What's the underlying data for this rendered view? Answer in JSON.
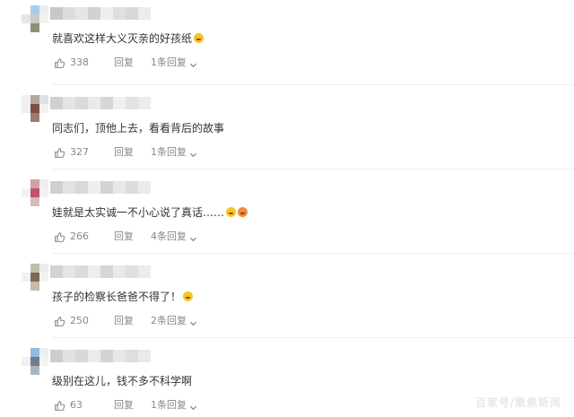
{
  "comments": [
    {
      "avatar_colors": [
        "#ffffff",
        "#a8cdea",
        "#e9eef2",
        "#e6e6e6",
        "#c9cbc6",
        "#f1f1f1",
        "#ffffff",
        "#8a9276",
        "#ffffff"
      ],
      "name_mosaic": [
        "#c8c8c8",
        "#dcdcdc",
        "#e6e6e6",
        "#d2d2d2",
        "#eeeeee",
        "#e0e0e0",
        "#d8d8d8",
        "#ececec"
      ],
      "text": "就喜欢这样大义灭亲的好孩纸",
      "emojis": [
        "yellow"
      ],
      "likes": "338",
      "reply_label": "回复",
      "replies_label": "1条回复"
    },
    {
      "avatar_colors": [
        "#f0f0f0",
        "#b5a79e",
        "#e0e0e0",
        "#efefef",
        "#7f4e43",
        "#f2f2f2",
        "#ffffff",
        "#a07870",
        "#ffffff"
      ],
      "name_mosaic": [
        "#d0d0d0",
        "#e4e4e4",
        "#dadada",
        "#eaeaea",
        "#d6d6d6",
        "#efefef",
        "#e2e2e2",
        "#ececec"
      ],
      "text": "同志们，顶他上去，看看背后的故事",
      "emojis": [],
      "likes": "327",
      "reply_label": "回复",
      "replies_label": "1条回复"
    },
    {
      "avatar_colors": [
        "#ffffff",
        "#c9a3a9",
        "#efefef",
        "#f2f2f2",
        "#c0526a",
        "#f3f3f3",
        "#ffffff",
        "#d8b8be",
        "#ffffff"
      ],
      "name_mosaic": [
        "#cfcfcf",
        "#e2e2e2",
        "#d9d9d9",
        "#eeeeee",
        "#d4d4d4",
        "#e8e8e8",
        "#dddddd",
        "#ebebeb"
      ],
      "text": "娃就是太实诚一不小心说了真话……",
      "emojis": [
        "yellow",
        "red"
      ],
      "likes": "266",
      "reply_label": "回复",
      "replies_label": "4条回复"
    },
    {
      "avatar_colors": [
        "#ffffff",
        "#bdbfae",
        "#ececec",
        "#f1f1f1",
        "#7b6a55",
        "#f3f3f3",
        "#ffffff",
        "#c8b9a8",
        "#ffffff"
      ],
      "name_mosaic": [
        "#d3d3d3",
        "#e5e5e5",
        "#dbdbdb",
        "#eeeeee",
        "#d6d6d6",
        "#e9e9e9",
        "#e0e0e0",
        "#ececec"
      ],
      "text": "孩子的检察长爸爸不得了！",
      "emojis": [
        "yellow"
      ],
      "likes": "250",
      "reply_label": "回复",
      "replies_label": "2条回复"
    },
    {
      "avatar_colors": [
        "#ffffff",
        "#93bde0",
        "#eaeef1",
        "#f0f0f0",
        "#6f7c8a",
        "#f2f2f2",
        "#ffffff",
        "#a9b4bd",
        "#ffffff"
      ],
      "name_mosaic": [
        "#cdcdcd",
        "#e1e1e1",
        "#d8d8d8",
        "#ececec",
        "#d3d3d3",
        "#e7e7e7",
        "#dedede",
        "#eaeaea"
      ],
      "text": "级别在这儿，钱不多不科学啊",
      "emojis": [],
      "likes": "63",
      "reply_label": "回复",
      "replies_label": "1条回复"
    }
  ],
  "icons": {
    "like": "thumbs-up-icon",
    "expand": "chevron-down-icon"
  },
  "watermark": "百家号/聚焦新闻",
  "colors": {
    "text": "#333333",
    "meta": "#888888",
    "divider": "#eeeeee"
  }
}
